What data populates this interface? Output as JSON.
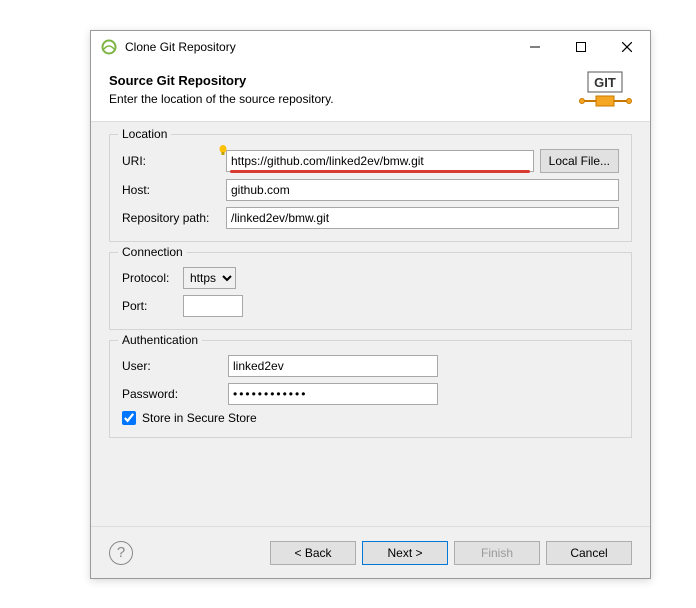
{
  "window": {
    "title": "Clone Git Repository"
  },
  "header": {
    "title": "Source Git Repository",
    "subtitle": "Enter the location of the source repository.",
    "badge": "GIT"
  },
  "location": {
    "legend": "Location",
    "uri_label": "URI:",
    "uri_value": "https://github.com/linked2ev/bmw.git",
    "local_file_btn": "Local File...",
    "host_label": "Host:",
    "host_value": "github.com",
    "repo_label": "Repository path:",
    "repo_value": "/linked2ev/bmw.git"
  },
  "connection": {
    "legend": "Connection",
    "protocol_label": "Protocol:",
    "protocol_value": "https",
    "port_label": "Port:",
    "port_value": ""
  },
  "auth": {
    "legend": "Authentication",
    "user_label": "User:",
    "user_value": "linked2ev",
    "password_label": "Password:",
    "password_value": "************",
    "store_label": "Store in Secure Store"
  },
  "footer": {
    "back": "< Back",
    "next": "Next >",
    "finish": "Finish",
    "cancel": "Cancel"
  }
}
